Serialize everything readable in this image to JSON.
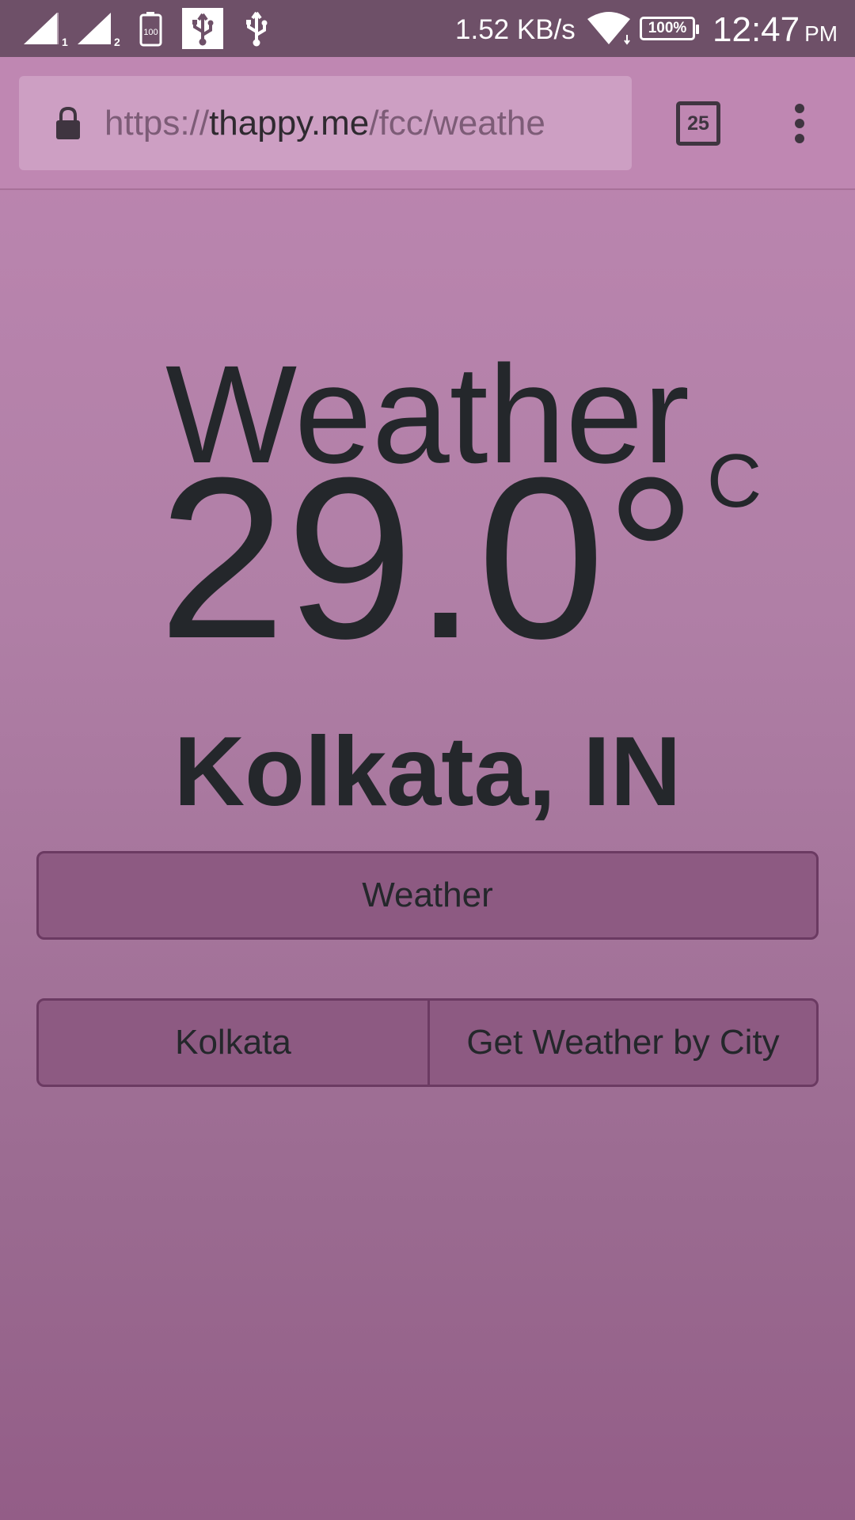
{
  "status_bar": {
    "network_speed": "1.52 KB/s",
    "battery_percent": "100%",
    "small_battery_label": "100",
    "time": "12:47",
    "ampm": "PM",
    "sim1_label": "1",
    "sim2_label": "2"
  },
  "browser": {
    "url_scheme": "https://",
    "url_domain": "thappy.me",
    "url_path": "/fcc/weathe",
    "tab_count": "25"
  },
  "page": {
    "title": "Weather",
    "temperature": "29.0°",
    "unit": "C",
    "location": "Kolkata, IN",
    "weather_button_label": "Weather",
    "city_input_value": "Kolkata",
    "city_button_label": "Get Weather by City"
  },
  "colors": {
    "status_bar_bg": "#6e5068",
    "toolbar_bg": "#bf87b2",
    "page_bg_top": "#be87b2",
    "page_bg_bottom": "#935d87",
    "button_bg": "#8d5a82",
    "text": "#24272b"
  },
  "icons": [
    "signal-sim1-icon",
    "signal-sim2-icon",
    "battery-saver-icon",
    "usb-debug-icon",
    "usb-icon",
    "wifi-icon",
    "battery-icon",
    "lock-icon",
    "tabs-icon",
    "more-vert-icon"
  ]
}
